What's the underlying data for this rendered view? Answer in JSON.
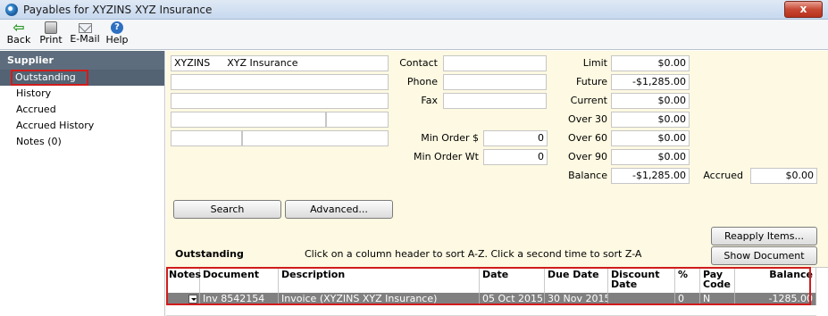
{
  "window": {
    "title": "Payables for XYZINS XYZ Insurance",
    "close_label": "x"
  },
  "toolbar": {
    "back_label": "Back",
    "print_label": "Print",
    "email_label": "E-Mail",
    "help_label": "Help",
    "icons": [
      "back-arrow-icon",
      "print-icon",
      "email-icon",
      "help-icon"
    ]
  },
  "sidebar": {
    "header": "Supplier",
    "items": [
      {
        "label": "Outstanding",
        "active": true
      },
      {
        "label": "History"
      },
      {
        "label": "Accrued"
      },
      {
        "label": "Accrued History"
      },
      {
        "label": "Notes (0)"
      }
    ]
  },
  "supplier": {
    "code": "XYZINS",
    "name": "XYZ Insurance",
    "address1": "",
    "address2": "",
    "address3": "",
    "address4": "",
    "address5": "",
    "address6": ""
  },
  "contact": {
    "contact_label": "Contact",
    "contact_value": "",
    "phone_label": "Phone",
    "phone_value": "",
    "fax_label": "Fax",
    "fax_value": "",
    "min_order_label": "Min Order $",
    "min_order_value": "0",
    "min_order_wt_label": "Min Order Wt",
    "min_order_wt_value": "0"
  },
  "aging": {
    "limit_label": "Limit",
    "limit_value": "$0.00",
    "future_label": "Future",
    "future_value": "-$1,285.00",
    "current_label": "Current",
    "current_value": "$0.00",
    "over30_label": "Over 30",
    "over30_value": "$0.00",
    "over60_label": "Over 60",
    "over60_value": "$0.00",
    "over90_label": "Over 90",
    "over90_value": "$0.00",
    "balance_label": "Balance",
    "balance_value": "-$1,285.00",
    "accrued_label": "Accrued",
    "accrued_value": "$0.00"
  },
  "actions": {
    "search_label": "Search",
    "advanced_label": "Advanced...",
    "reapply_label": "Reapply Items...",
    "show_document_label": "Show Document"
  },
  "grid": {
    "title": "Outstanding",
    "hint": "Click on a column header to sort A-Z.  Click a second time to sort Z-A",
    "columns": {
      "notes": "Notes",
      "document": "Document",
      "description": "Description",
      "date": "Date",
      "due_date": "Due Date",
      "discount_date": "Discount Date",
      "percent": "%",
      "pay_code": "Pay Code",
      "balance": "Balance"
    },
    "rows": [
      {
        "document": "Inv 8542154",
        "description": "Invoice (XYZINS XYZ Insurance)",
        "date": "05 Oct 2015",
        "due_date": "30 Nov 2015",
        "discount_date": "",
        "percent": "0",
        "pay_code": "N",
        "balance": "-1285.00"
      }
    ]
  }
}
